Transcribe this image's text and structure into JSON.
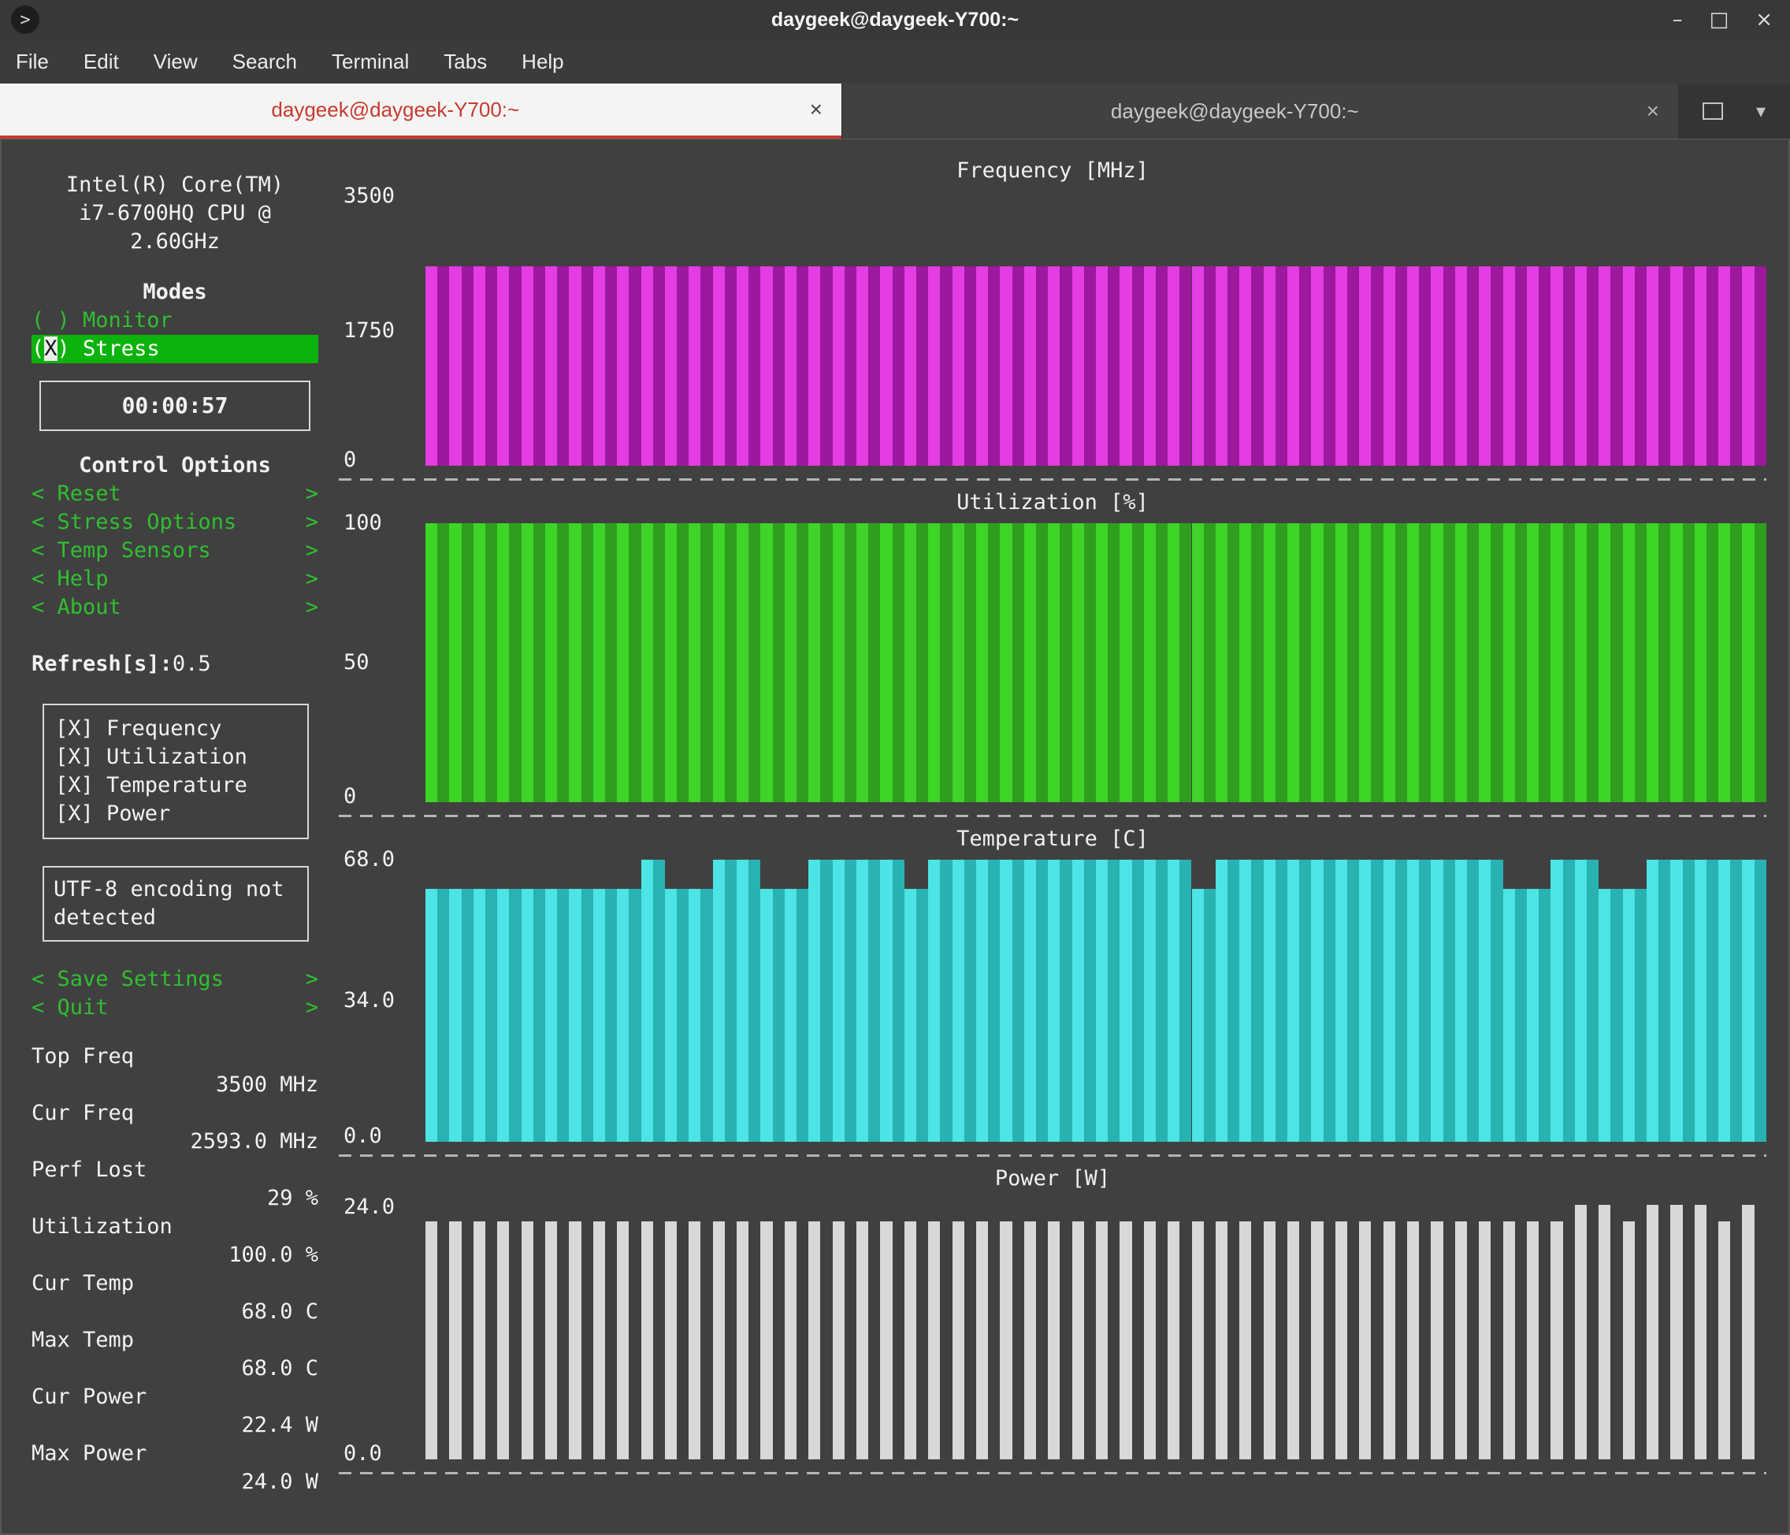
{
  "window": {
    "title": "daygeek@daygeek-Y700:~",
    "app_icon_glyph": ">",
    "controls": {
      "minimize": "–",
      "maximize": "□",
      "close": "×"
    }
  },
  "menu": {
    "items": [
      "File",
      "Edit",
      "View",
      "Search",
      "Terminal",
      "Tabs",
      "Help"
    ]
  },
  "tabs": {
    "active": {
      "label": "daygeek@daygeek-Y700:~",
      "close": "×"
    },
    "inactive": {
      "label": "daygeek@daygeek-Y700:~",
      "close": "×"
    },
    "dropdown": "▾"
  },
  "sidebar": {
    "cpu_model": [
      "Intel(R) Core(TM)",
      "i7-6700HQ CPU @",
      "2.60GHz"
    ],
    "bracket_left": "<",
    "bracket_right": ">",
    "modes": {
      "title": "Modes",
      "monitor_label": "( ) Monitor",
      "stress_pre": "(",
      "stress_cursor": "X",
      "stress_post": ") Stress"
    },
    "timer": "00:00:57",
    "control_options": {
      "title": "Control Options",
      "items": [
        "Reset",
        "Stress Options",
        "Temp Sensors",
        "Help",
        "About"
      ]
    },
    "refresh": {
      "label": "Refresh[s]:",
      "value": "0.5"
    },
    "graph_toggles": [
      "[X] Frequency",
      "[X] Utilization",
      "[X] Temperature",
      "[X] Power"
    ],
    "notice": "UTF-8 encoding not detected",
    "actions": [
      "Save Settings",
      "Quit"
    ],
    "stats": [
      {
        "label": "Top Freq",
        "value": "3500 MHz"
      },
      {
        "label": "Cur Freq",
        "value": "2593.0 MHz"
      },
      {
        "label": "Perf Lost",
        "value": "29 %"
      },
      {
        "label": "Utilization",
        "value": "100.0 %"
      },
      {
        "label": "Cur Temp",
        "value": "68.0 C"
      },
      {
        "label": "Max Temp",
        "value": "68.0 C"
      },
      {
        "label": "Cur Power",
        "value": "22.4 W"
      },
      {
        "label": "Max Power",
        "value": "24.0 W"
      }
    ]
  },
  "chart_data": [
    {
      "type": "bar",
      "title": "Frequency [MHz]",
      "xlabel": "",
      "ylabel": "MHz",
      "ylim": [
        0,
        3500
      ],
      "yticks": [
        {
          "label": "3500",
          "frac": 0.0
        },
        {
          "label": "1750",
          "frac": 0.5
        },
        {
          "label": "0",
          "frac": 0.98
        }
      ],
      "colors": {
        "bright": "#e33de3",
        "dark": "#9d189d"
      },
      "values": [
        2593,
        2593,
        2593,
        2593,
        2593,
        2593,
        2593,
        2593,
        2593,
        2593,
        2593,
        2593,
        2593,
        2593,
        2593,
        2593,
        2593,
        2593,
        2593,
        2593,
        2593,
        2593,
        2593,
        2593,
        2593,
        2593,
        2593,
        2593,
        2593,
        2593,
        2593,
        2593,
        2593,
        2593,
        2593,
        2593,
        2593,
        2593,
        2593,
        2593,
        2593,
        2593,
        2593,
        2593,
        2593,
        2593,
        2593,
        2593,
        2593,
        2593,
        2593,
        2593,
        2593,
        2593,
        2593,
        2593
      ]
    },
    {
      "type": "bar",
      "title": "Utilization [%]",
      "xlabel": "",
      "ylabel": "%",
      "ylim": [
        0,
        100
      ],
      "yticks": [
        {
          "label": "100",
          "frac": 0.0
        },
        {
          "label": "50",
          "frac": 0.5
        },
        {
          "label": "0",
          "frac": 0.98
        }
      ],
      "colors": {
        "bright": "#3ed428",
        "dark": "#2f9e1f"
      },
      "values": [
        100,
        100,
        100,
        100,
        100,
        100,
        100,
        100,
        100,
        100,
        100,
        100,
        100,
        100,
        100,
        100,
        100,
        100,
        100,
        100,
        100,
        100,
        100,
        100,
        100,
        100,
        100,
        100,
        100,
        100,
        100,
        100,
        100,
        100,
        100,
        100,
        100,
        100,
        100,
        100,
        100,
        100,
        100,
        100,
        100,
        100,
        100,
        100,
        100,
        100,
        100,
        100,
        100,
        100,
        100,
        100
      ]
    },
    {
      "type": "bar",
      "title": "Temperature [C]",
      "xlabel": "",
      "ylabel": "C",
      "ylim": [
        0,
        68
      ],
      "yticks": [
        {
          "label": "68.0",
          "frac": 0.0
        },
        {
          "label": "34.0",
          "frac": 0.5
        },
        {
          "label": "0.0",
          "frac": 0.98
        }
      ],
      "colors": {
        "bright": "#4ce4e4",
        "dark": "#28b2b2"
      },
      "values": [
        61,
        61,
        61,
        61,
        61,
        61,
        61,
        61,
        61,
        68,
        61,
        61,
        68,
        68,
        61,
        61,
        68,
        68,
        68,
        68,
        61,
        68,
        68,
        68,
        68,
        68,
        68,
        68,
        68,
        68,
        68,
        68,
        61,
        68,
        68,
        68,
        68,
        68,
        68,
        68,
        68,
        68,
        68,
        68,
        68,
        61,
        61,
        68,
        68,
        61,
        61,
        68,
        68,
        68,
        68,
        68
      ]
    },
    {
      "type": "bar",
      "title": "Power [W]",
      "xlabel": "",
      "ylabel": "W",
      "ylim": [
        0,
        24.5
      ],
      "yticks": [
        {
          "label": "24.0",
          "frac": 0.03
        },
        {
          "label": "0.0",
          "frac": 0.98
        }
      ],
      "colors": {
        "bright": "#d8d8d8",
        "dark": "transparent"
      },
      "values": [
        22.4,
        22.4,
        22.4,
        22.4,
        22.4,
        22.4,
        22.4,
        22.4,
        22.4,
        22.4,
        22.4,
        22.4,
        22.4,
        22.4,
        22.4,
        22.4,
        22.4,
        22.4,
        22.4,
        22.4,
        22.4,
        22.4,
        22.4,
        22.4,
        22.4,
        22.4,
        22.4,
        22.4,
        22.4,
        22.4,
        22.4,
        22.4,
        22.4,
        22.4,
        22.4,
        22.4,
        22.4,
        22.4,
        22.4,
        22.4,
        22.4,
        22.4,
        22.4,
        22.4,
        22.4,
        22.4,
        22.4,
        22.4,
        24,
        24,
        22.4,
        24,
        24,
        24,
        22.4,
        24
      ]
    }
  ],
  "colors": {
    "terminal_bg": "#404040",
    "chrome_bg": "#383838",
    "accent_green": "#2fbf2f",
    "selected_green_bg": "#0db30d",
    "tab_active_text": "#c63b2e",
    "box_border": "#d8d8d8"
  }
}
